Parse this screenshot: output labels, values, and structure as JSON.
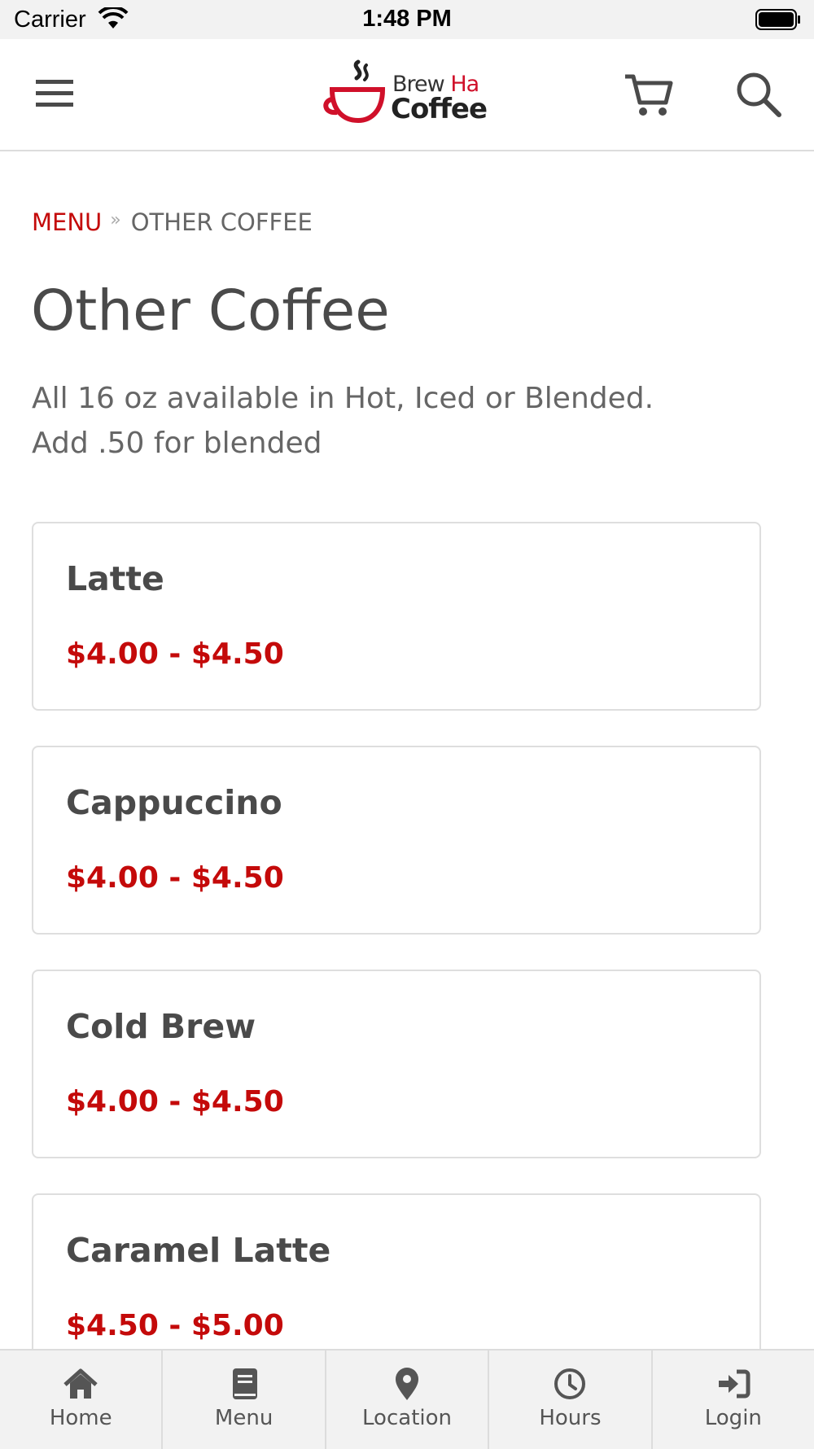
{
  "status_bar": {
    "carrier": "Carrier",
    "time": "1:48 PM"
  },
  "header": {
    "logo_text_line1": "Brew",
    "logo_text_accent": "Ha",
    "logo_text_line2": "Coffee",
    "icons": [
      "hamburger-menu-icon",
      "cart-icon",
      "search-icon"
    ]
  },
  "breadcrumb": {
    "parent": "MENU",
    "separator": "»",
    "current": "OTHER COFFEE"
  },
  "page": {
    "title": "Other Coffee",
    "description_line1": "All 16 oz available in Hot, Iced or Blended.",
    "description_line2": "Add .50 for blended"
  },
  "items": [
    {
      "name": "Latte",
      "price": "$4.00 - $4.50"
    },
    {
      "name": "Cappuccino",
      "price": "$4.00 - $4.50"
    },
    {
      "name": "Cold Brew",
      "price": "$4.00 - $4.50"
    },
    {
      "name": "Caramel Latte",
      "price": "$4.50 - $5.00"
    }
  ],
  "tabbar": [
    {
      "label": "Home",
      "icon": "home-icon"
    },
    {
      "label": "Menu",
      "icon": "book-icon"
    },
    {
      "label": "Location",
      "icon": "map-pin-icon"
    },
    {
      "label": "Hours",
      "icon": "clock-icon"
    },
    {
      "label": "Login",
      "icon": "login-icon"
    }
  ],
  "colors": {
    "accent": "#c40a0a",
    "text": "#4a4a4a",
    "bar_bg": "#f2f2f2"
  }
}
